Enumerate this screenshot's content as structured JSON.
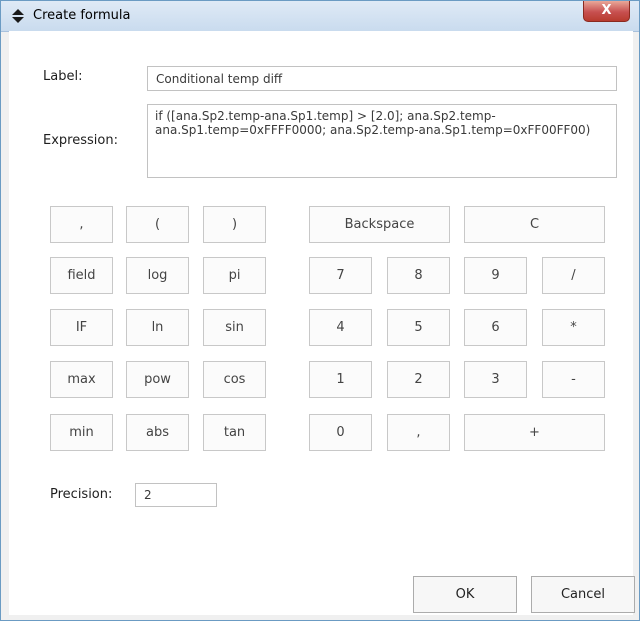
{
  "window": {
    "title": "Create formula",
    "close_label": "X"
  },
  "form": {
    "label_caption": "Label:",
    "label_value": "Conditional temp diff",
    "expression_caption": "Expression:",
    "expression_value": "if ([ana.Sp2.temp-ana.Sp1.temp] > [2.0]; ana.Sp2.temp-ana.Sp1.temp=0xFFFF0000; ana.Sp2.temp-ana.Sp1.temp=0xFF00FF00)",
    "precision_caption": "Precision:",
    "precision_value": "2"
  },
  "keypad": {
    "comma": ",",
    "lparen": "(",
    "rparen": ")",
    "field": "field",
    "log": "log",
    "pi": "pi",
    "if": "IF",
    "ln": "ln",
    "sin": "sin",
    "max": "max",
    "pow": "pow",
    "cos": "cos",
    "min": "min",
    "abs": "abs",
    "tan": "tan",
    "backspace": "Backspace",
    "clear": "C",
    "d7": "7",
    "d8": "8",
    "d9": "9",
    "divide": "/",
    "d4": "4",
    "d5": "5",
    "d6": "6",
    "multiply": "*",
    "d1": "1",
    "d2": "2",
    "d3": "3",
    "minus": "-",
    "d0": "0",
    "decimal": ",",
    "plus": "+"
  },
  "footer": {
    "ok_label": "OK",
    "cancel_label": "Cancel"
  }
}
